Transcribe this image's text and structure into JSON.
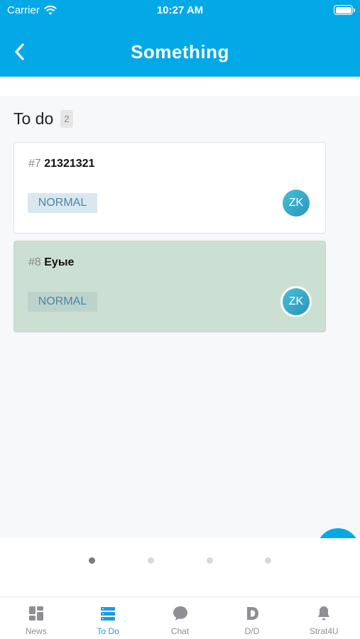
{
  "status_bar": {
    "carrier": "Carrier",
    "time": "10:27 AM"
  },
  "header": {
    "title": "Something"
  },
  "section": {
    "title": "To do",
    "count": "2"
  },
  "tasks": [
    {
      "number": "#7",
      "name": "21321321",
      "priority": "NORMAL",
      "assignee": "ZK",
      "selected": false
    },
    {
      "number": "#8",
      "name": "Еуые",
      "priority": "NORMAL",
      "assignee": "ZK",
      "selected": true
    }
  ],
  "pager": {
    "pages": 4,
    "active": 0
  },
  "tabs": [
    {
      "label": "News",
      "icon": "dashboard-icon",
      "active": false
    },
    {
      "label": "To Do",
      "icon": "list-icon",
      "active": true
    },
    {
      "label": "Chat",
      "icon": "chat-bubble-icon",
      "active": false
    },
    {
      "label": "D/D",
      "icon": "d-letter-icon",
      "active": false
    },
    {
      "label": "Strat4U",
      "icon": "bell-icon",
      "active": false
    }
  ],
  "colors": {
    "accent": "#03a9e6",
    "tab_active": "#1a9ce0",
    "selected_card": "#ccdfd3"
  }
}
